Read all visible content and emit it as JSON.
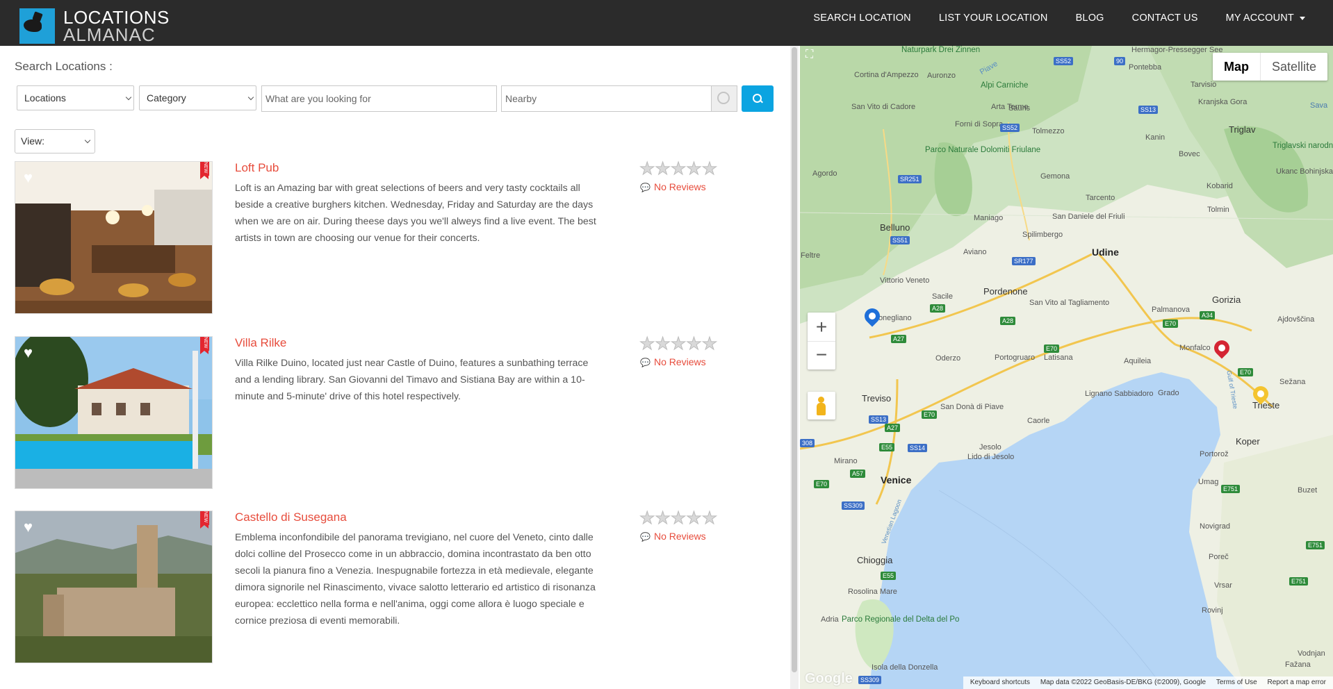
{
  "header": {
    "logo_line1": "LOCATIONS",
    "logo_line2": "ALMANAC",
    "nav": [
      "SEARCH LOCATION",
      "LIST YOUR LOCATION",
      "BLOG",
      "CONTACT US",
      "MY ACCOUNT"
    ]
  },
  "search": {
    "label": "Search Locations :",
    "locations_select": "Locations",
    "category_select": "Category",
    "keyword_placeholder": "What are you looking for",
    "nearby_placeholder": "Nearby",
    "view_select": "View:"
  },
  "listings": [
    {
      "title": "Loft Pub",
      "description": "Loft is an Amazing bar with great selections of beers and very tasty cocktails all beside a creative burghers kitchen. Wednesday, Friday and Saturday are the days when we are on air. During theese days you we'll alweys find a live event. The best artists in town are choosing our venue for their concerts.",
      "rating": 0,
      "reviews": "No Reviews",
      "badge": "NEW"
    },
    {
      "title": "Villa Rilke",
      "description": "Villa Rilke Duino, located just near Castle of Duino, features a sunbathing terrace and a lending library. San Giovanni del Timavo and Sistiana Bay are within a 10-minute and 5-minute' drive of this hotel respectively.",
      "rating": 0,
      "reviews": "No Reviews",
      "badge": "NEW"
    },
    {
      "title": "Castello di Susegana",
      "description": "Emblema inconfondibile del panorama trevigiano, nel cuore del Veneto, cinto dalle dolci colline del Prosecco come in un abbraccio, domina incontrastato da ben otto secoli la pianura fino a Venezia. Inespugnabile fortezza in età medievale, elegante dimora signorile nel Rinascimento, vivace salotto letterario ed artistico di risonanza europea: ecclettico nella forma e nell'anima, oggi come allora è luogo speciale e cornice preziosa di eventi memorabili.",
      "rating": 0,
      "reviews": "No Reviews",
      "badge": "NEW"
    }
  ],
  "map": {
    "type_map": "Map",
    "type_satellite": "Satellite",
    "zoom_in": "+",
    "zoom_out": "−",
    "google": "Google",
    "attribution": [
      "Keyboard shortcuts",
      "Map data ©2022 GeoBasis-DE/BKG (©2009), Google",
      "Terms of Use",
      "Report a map error"
    ],
    "labels": {
      "venice": "Venice",
      "udine": "Udine",
      "trieste": "Trieste",
      "treviso": "Treviso",
      "belluno": "Belluno",
      "pordenone": "Pordenone",
      "gorizia": "Gorizia",
      "koper": "Koper",
      "chioggia": "Chioggia",
      "triglav": "Triglav",
      "kanin": "Kanin",
      "tolmin": "Tolmin",
      "bovec": "Bovec",
      "kobarid": "Kobarid",
      "vittorio_veneto": "Vittorio Veneto",
      "conegliano": "Conegliano",
      "oderzo": "Oderzo",
      "portogruaro": "Portogruaro",
      "latisana": "Latisana",
      "san_dona": "San Donà di Piave",
      "caorle": "Caorle",
      "jesolo": "Jesolo",
      "lido_jesolo": "Lido di Jesolo",
      "lignano": "Lignano Sabbiadoro",
      "grado": "Grado",
      "aquileia": "Aquileia",
      "monfalcone": "Monfalco",
      "palmanova": "Palmanova",
      "mirano": "Mirano",
      "rosolina": "Rosolina Mare",
      "adria": "Adria",
      "isola": "Isola della Donzella",
      "umag": "Umag",
      "novigrad": "Novigrad",
      "porec": "Poreč",
      "vrsar": "Vrsar",
      "rovinj": "Rovinj",
      "buzet": "Buzet",
      "portoroz": "Portorož",
      "sezana": "Sežana",
      "ajdovscina": "Ajdovščina",
      "cortina": "Cortina d'Ampezzo",
      "alpi_carniche": "Alpi Carniche",
      "arta_terme": "Arta Terme",
      "tolmezzo": "Tolmezzo",
      "gemona": "Gemona",
      "tarcento": "Tarcento",
      "san_daniele": "San Daniele del Friuli",
      "spilimbergo": "Spilimbergo",
      "maniago": "Maniago",
      "aviano": "Aviano",
      "sacile": "Sacile",
      "feltre": "Feltre",
      "agordo": "Agordo",
      "sauris": "Sauris",
      "forni": "Forni di Sopra",
      "pontebba": "Pontebba",
      "tarvisio": "Tarvisio",
      "kranjska": "Kranjska Gora",
      "auronzo": "Auronzo",
      "san_vito": "San Vito di Cadore",
      "dolomiti": "Parco Naturale Dolomiti Friulane",
      "triglavski": "Triglavski narodni park",
      "delta_po": "Parco Regionale del Delta del Po",
      "drei_zinnen": "Naturpark Drei Zinnen",
      "ukanc": "Ukanc Bohinjska Bistrica",
      "vodnjan": "Vodnjan",
      "fazana": "Fažana",
      "piave": "Piave",
      "san_vito_tag": "San Vito al Tagliamento",
      "hermagor": "Hermagor-Pressegger See",
      "sava": "Sava",
      "gulf_trieste": "Gulf of Trieste",
      "veneta_lagoon": "Venetian Lagoon"
    },
    "roads": [
      "SS52",
      "SS13",
      "SS52",
      "SR251",
      "SS51",
      "SR177",
      "A28",
      "A28",
      "A27",
      "E70",
      "E70",
      "A34",
      "E70",
      "A27",
      "SS13",
      "E70",
      "E55",
      "SS14",
      "A57",
      "E70",
      "SS309",
      "E55",
      "SS309",
      "E751",
      "E751",
      "E751",
      "90",
      "308"
    ]
  }
}
